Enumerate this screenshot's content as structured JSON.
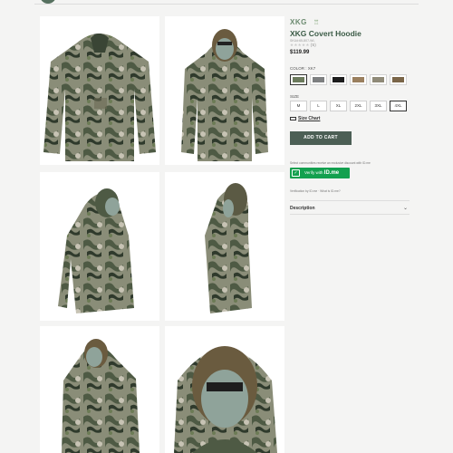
{
  "product": {
    "brand": "XKG",
    "title": "XKG Covert Hoodie",
    "sku": "SKU#:65-807-WL",
    "stars": "★★★★★",
    "review_count": "(5)",
    "price": "$119.99"
  },
  "color": {
    "label": "COLOR : XK7",
    "swatches": [
      {
        "name": "xk7",
        "color": "#6b7a5c",
        "selected": true
      },
      {
        "name": "gray",
        "color": "#7d7f80",
        "selected": false
      },
      {
        "name": "black",
        "color": "#1c1c1c",
        "selected": false
      },
      {
        "name": "tan",
        "color": "#9a7f5e",
        "selected": false
      },
      {
        "name": "camo-light",
        "color": "#8f8a78",
        "selected": false
      },
      {
        "name": "camo-brown",
        "color": "#7a6548",
        "selected": false
      }
    ]
  },
  "size": {
    "label": "SIZE",
    "options": [
      "M",
      "L",
      "XL",
      "2XL",
      "3XL",
      "4XL"
    ],
    "selected": "4XL",
    "chart_label": "Size Chart"
  },
  "cart": {
    "add_label": "ADD TO CART"
  },
  "idme": {
    "promo_text": "Select communities receive an exclusive discount with ID.me",
    "button_label": "Verify with",
    "logo_text": "ID.me",
    "info_text": "Verification by ID.me · What is ID.me?"
  },
  "description": {
    "label": "Description"
  },
  "colors": {
    "accent": "#4c5f55",
    "title": "#3b5b46",
    "idme": "#13a04f"
  }
}
